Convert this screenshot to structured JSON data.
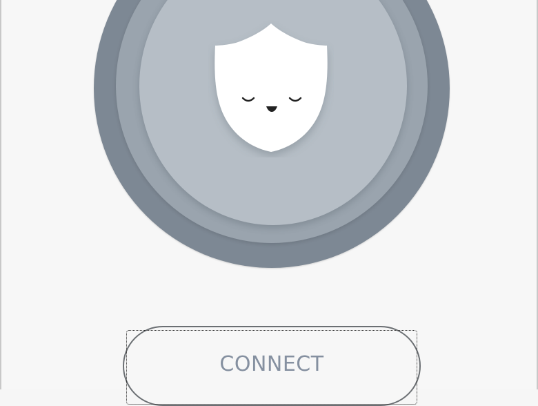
{
  "connection": {
    "button_label": "CONNECT"
  },
  "colors": {
    "orb_outer": "#7d8894",
    "orb_middle": "#9aa4ae",
    "orb_inner": "#b6bec6",
    "mascot": "#ffffff",
    "button_text": "#8590a0",
    "button_border": "#6b6f73"
  },
  "icons": {
    "mascot": "shield-mascot-icon"
  }
}
